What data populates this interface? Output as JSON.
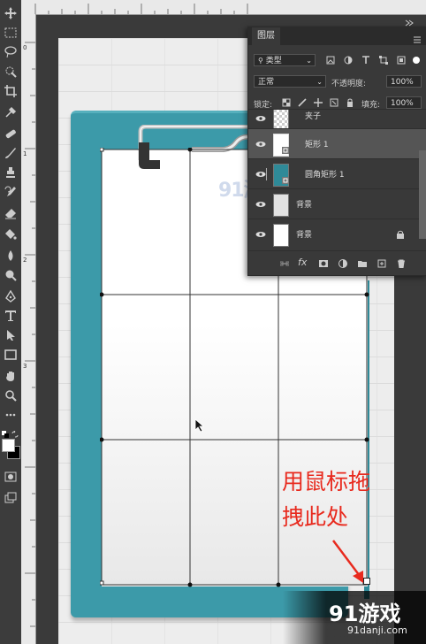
{
  "layers_panel": {
    "title": "图层",
    "filter_kind": "类型",
    "blend_mode": "正常",
    "opacity_label": "不透明度:",
    "opacity_value": "100%",
    "lock_label": "锁定:",
    "fill_label": "填充:",
    "fill_value": "100%",
    "layers": [
      {
        "name": "夹子",
        "thumb": "checker",
        "selected": false
      },
      {
        "name": "矩形 1",
        "thumb": "white",
        "selected": true
      },
      {
        "name": "圆角矩形 1",
        "thumb": "teal",
        "selected": false
      },
      {
        "name": "背景",
        "thumb": "light",
        "selected": false
      },
      {
        "name": "背景",
        "thumb": "white",
        "selected": false,
        "locked": true
      }
    ],
    "footer_icons": [
      "link-icon",
      "fx-icon",
      "mask-icon",
      "adjustment-icon",
      "folder-icon",
      "new-layer-icon",
      "trash-icon"
    ],
    "fx_label": "fx"
  },
  "annotation": {
    "line1": "用鼠标拖",
    "line2": "拽此处",
    "color": "#e82a1e"
  },
  "ruler": {
    "left_marks": [
      "0",
      "1",
      "2",
      "3"
    ]
  },
  "watermarks": {
    "logo_text": "91游戏",
    "site": "91danji.com"
  },
  "colors": {
    "board": "#3c9aa9",
    "panel": "#393939",
    "toolbar": "#3c3c3c"
  }
}
